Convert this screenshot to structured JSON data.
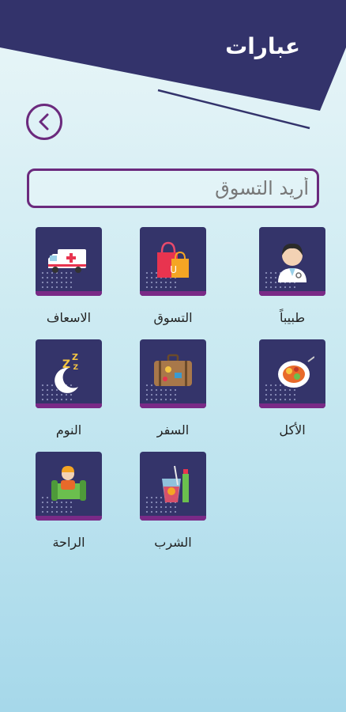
{
  "header": {
    "title": "عبارات"
  },
  "back_button": {
    "icon": "chevron-left-icon"
  },
  "search": {
    "value": "أريد التسوق",
    "placeholder": "أريد التسوق"
  },
  "categories": [
    {
      "label": "طبيباً",
      "icon": "doctor-icon"
    },
    {
      "label": "التسوق",
      "icon": "shopping-bags-icon"
    },
    {
      "label": "الاسعاف",
      "icon": "ambulance-icon"
    },
    {
      "label": "الأكل",
      "icon": "food-plate-icon"
    },
    {
      "label": "السفر",
      "icon": "suitcase-icon"
    },
    {
      "label": "النوم",
      "icon": "moon-sleep-icon"
    },
    {
      "label": "الشرب",
      "icon": "drink-glass-icon"
    },
    {
      "label": "الراحة",
      "icon": "resting-person-icon"
    }
  ],
  "colors": {
    "header_navy": "#33336b",
    "accent_purple": "#6b2a7d",
    "card_navy": "#34346a"
  }
}
